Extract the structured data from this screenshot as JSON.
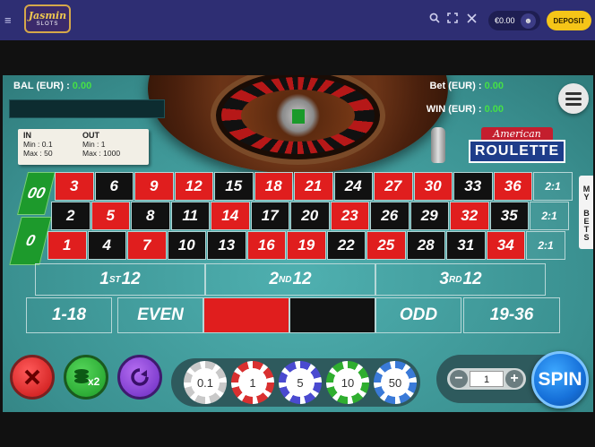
{
  "topbar": {
    "logo_line1": "Jasmin",
    "logo_line2": "SLOTS",
    "balance": "€0.00",
    "deposit_label": "DEPOSIT",
    "icons": [
      "menu-icon",
      "search-icon",
      "fullscreen-icon",
      "close-icon",
      "user-icon"
    ]
  },
  "game": {
    "balance_label": "BAL (EUR) :",
    "balance_value": "0.00",
    "bet_label": "Bet (EUR) :",
    "bet_value": "0.00",
    "win_label": "WIN (EUR) :",
    "win_value": "0.00",
    "limits": {
      "in_title": "IN",
      "in_min": "Min : 0.1",
      "in_max": "Max : 50",
      "out_title": "OUT",
      "out_min": "Min : 1",
      "out_max": "Max : 1000"
    },
    "logo_top": "American",
    "logo_bottom": "ROULETTE",
    "my_bets": "MY BETS"
  },
  "board": {
    "zero": "0",
    "double_zero": "00",
    "rows": [
      [
        {
          "n": "3",
          "c": "red"
        },
        {
          "n": "6",
          "c": "black"
        },
        {
          "n": "9",
          "c": "red"
        },
        {
          "n": "12",
          "c": "red"
        },
        {
          "n": "15",
          "c": "black"
        },
        {
          "n": "18",
          "c": "red"
        },
        {
          "n": "21",
          "c": "red"
        },
        {
          "n": "24",
          "c": "black"
        },
        {
          "n": "27",
          "c": "red"
        },
        {
          "n": "30",
          "c": "red"
        },
        {
          "n": "33",
          "c": "black"
        },
        {
          "n": "36",
          "c": "red"
        }
      ],
      [
        {
          "n": "2",
          "c": "black"
        },
        {
          "n": "5",
          "c": "red"
        },
        {
          "n": "8",
          "c": "black"
        },
        {
          "n": "11",
          "c": "black"
        },
        {
          "n": "14",
          "c": "red"
        },
        {
          "n": "17",
          "c": "black"
        },
        {
          "n": "20",
          "c": "black"
        },
        {
          "n": "23",
          "c": "red"
        },
        {
          "n": "26",
          "c": "black"
        },
        {
          "n": "29",
          "c": "black"
        },
        {
          "n": "32",
          "c": "red"
        },
        {
          "n": "35",
          "c": "black"
        }
      ],
      [
        {
          "n": "1",
          "c": "red"
        },
        {
          "n": "4",
          "c": "black"
        },
        {
          "n": "7",
          "c": "red"
        },
        {
          "n": "10",
          "c": "black"
        },
        {
          "n": "13",
          "c": "black"
        },
        {
          "n": "16",
          "c": "red"
        },
        {
          "n": "19",
          "c": "red"
        },
        {
          "n": "22",
          "c": "black"
        },
        {
          "n": "25",
          "c": "red"
        },
        {
          "n": "28",
          "c": "black"
        },
        {
          "n": "31",
          "c": "black"
        },
        {
          "n": "34",
          "c": "red"
        }
      ]
    ],
    "column_bets": [
      "2:1",
      "2:1",
      "2:1"
    ],
    "dozens": [
      {
        "ord": "1",
        "sup": "ST",
        "num": "12"
      },
      {
        "ord": "2",
        "sup": "ND",
        "num": "12"
      },
      {
        "ord": "3",
        "sup": "RD",
        "num": "12"
      }
    ],
    "outside": [
      "1-18",
      "EVEN",
      "",
      "",
      "ODD",
      "19-36"
    ]
  },
  "controls": {
    "chips": [
      "0.1",
      "1",
      "5",
      "10",
      "50"
    ],
    "chip_colors": [
      "#c9c9c9",
      "#d93030",
      "#4a4ad0",
      "#2fae2f",
      "#3a7ad8"
    ],
    "stake": "1",
    "minus": "−",
    "plus": "+",
    "spin_label": "SPIN",
    "double_label": "x2"
  },
  "colors": {
    "red": "#e01e1e",
    "black": "#111111",
    "green": "#1d9a2c",
    "felt": "#3e9a9a",
    "deposit": "#f5c518"
  }
}
